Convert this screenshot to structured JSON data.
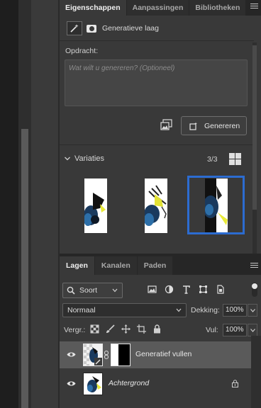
{
  "properties": {
    "tabs": [
      "Eigenschappen",
      "Aanpassingen",
      "Bibliotheken"
    ],
    "layer_type": "Generatieve laag",
    "prompt_label": "Opdracht:",
    "prompt_placeholder": "Wat wilt u genereren?  (Optioneel)",
    "generate_button": "Genereren",
    "variations_label": "Variaties",
    "variations_count": "3/3",
    "selected_variation": 3
  },
  "layers": {
    "tabs": [
      "Lagen",
      "Kanalen",
      "Paden"
    ],
    "filter_label": "Soort",
    "blend_mode": "Normaal",
    "opacity_label": "Dekking:",
    "opacity_value": "100%",
    "lock_label": "Vergr.:",
    "fill_label": "Vul:",
    "fill_value": "100%",
    "items": [
      {
        "name": "Generatief vullen",
        "selected": true
      },
      {
        "name": "Achtergrond",
        "locked": true
      }
    ]
  },
  "colors": {
    "panel_bg": "#393939",
    "selection_blue": "#2c6cd1",
    "selected_layer": "#5a5a5a"
  }
}
